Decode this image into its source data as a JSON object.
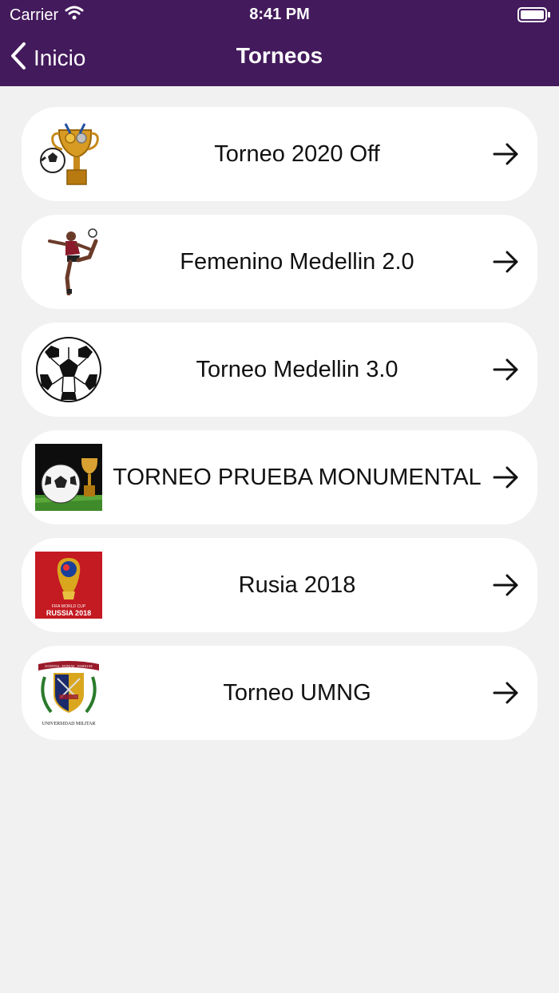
{
  "status_bar": {
    "carrier": "Carrier",
    "time": "8:41 PM"
  },
  "nav": {
    "back_label": "Inicio",
    "title": "Torneos"
  },
  "colors": {
    "header_bg": "#431a5c",
    "background": "#f1f1f1",
    "card_bg": "#ffffff"
  },
  "tournaments": [
    {
      "name": "Torneo 2020 Off",
      "icon": "trophy-ball-icon"
    },
    {
      "name": "Femenino Medellin 2.0",
      "icon": "female-player-icon"
    },
    {
      "name": "Torneo Medellin 3.0",
      "icon": "soccer-ball-icon"
    },
    {
      "name": "TORNEO PRUEBA MONUMENTAL",
      "icon": "ball-cup-photo-icon"
    },
    {
      "name": "Rusia 2018",
      "icon": "world-cup-logo-icon",
      "logo_text": [
        "FIFA WORLD CUP",
        "RUSSIA 2018"
      ]
    },
    {
      "name": "Torneo UMNG",
      "icon": "university-crest-icon",
      "logo_text": [
        "SCIENTIA · PATRIAE · FAMILIAE",
        "UNIVERSIDAD MILITAR"
      ]
    }
  ]
}
